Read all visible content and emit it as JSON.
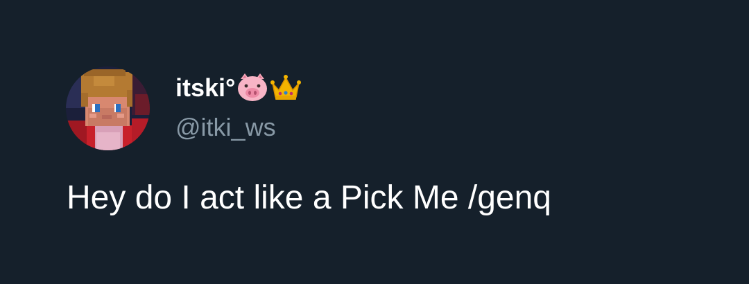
{
  "tweet": {
    "avatar_icon": "minecraft-skin-avatar",
    "display_name": "itski°",
    "name_emojis": [
      "pig-face-icon",
      "crown-icon"
    ],
    "handle": "@itki_ws",
    "text": "Hey do I act like a Pick Me /genq"
  },
  "colors": {
    "background": "#15202b",
    "name": "#ffffff",
    "handle": "#8899a6",
    "text": "#ffffff"
  }
}
